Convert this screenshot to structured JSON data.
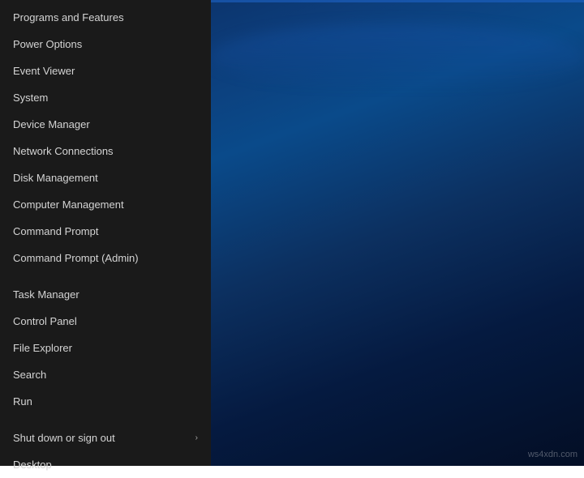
{
  "menu": {
    "items": [
      {
        "id": "programs-features",
        "label": "Programs and Features",
        "has_arrow": false,
        "divider_before": false
      },
      {
        "id": "power-options",
        "label": "Power Options",
        "has_arrow": false,
        "divider_before": false
      },
      {
        "id": "event-viewer",
        "label": "Event Viewer",
        "has_arrow": false,
        "divider_before": false
      },
      {
        "id": "system",
        "label": "System",
        "has_arrow": false,
        "divider_before": false
      },
      {
        "id": "device-manager",
        "label": "Device Manager",
        "has_arrow": false,
        "divider_before": false
      },
      {
        "id": "network-connections",
        "label": "Network Connections",
        "has_arrow": false,
        "divider_before": false
      },
      {
        "id": "disk-management",
        "label": "Disk Management",
        "has_arrow": false,
        "divider_before": false
      },
      {
        "id": "computer-management",
        "label": "Computer Management",
        "has_arrow": false,
        "divider_before": false
      },
      {
        "id": "command-prompt",
        "label": "Command Prompt",
        "has_arrow": false,
        "divider_before": false
      },
      {
        "id": "command-prompt-admin",
        "label": "Command Prompt (Admin)",
        "has_arrow": false,
        "divider_before": false
      },
      {
        "id": "divider1",
        "label": "",
        "is_divider": true
      },
      {
        "id": "task-manager",
        "label": "Task Manager",
        "has_arrow": false,
        "divider_before": false
      },
      {
        "id": "control-panel",
        "label": "Control Panel",
        "has_arrow": false,
        "divider_before": false
      },
      {
        "id": "file-explorer",
        "label": "File Explorer",
        "has_arrow": false,
        "divider_before": false
      },
      {
        "id": "search",
        "label": "Search",
        "has_arrow": false,
        "divider_before": false
      },
      {
        "id": "run",
        "label": "Run",
        "has_arrow": false,
        "divider_before": false
      },
      {
        "id": "divider2",
        "label": "",
        "is_divider": true
      },
      {
        "id": "shut-down-sign-out",
        "label": "Shut down or sign out",
        "has_arrow": true,
        "divider_before": false
      },
      {
        "id": "desktop",
        "label": "Desktop",
        "has_arrow": false,
        "divider_before": false
      }
    ],
    "arrow_char": "›"
  },
  "watermark": {
    "text": "ws4xdn.com"
  }
}
